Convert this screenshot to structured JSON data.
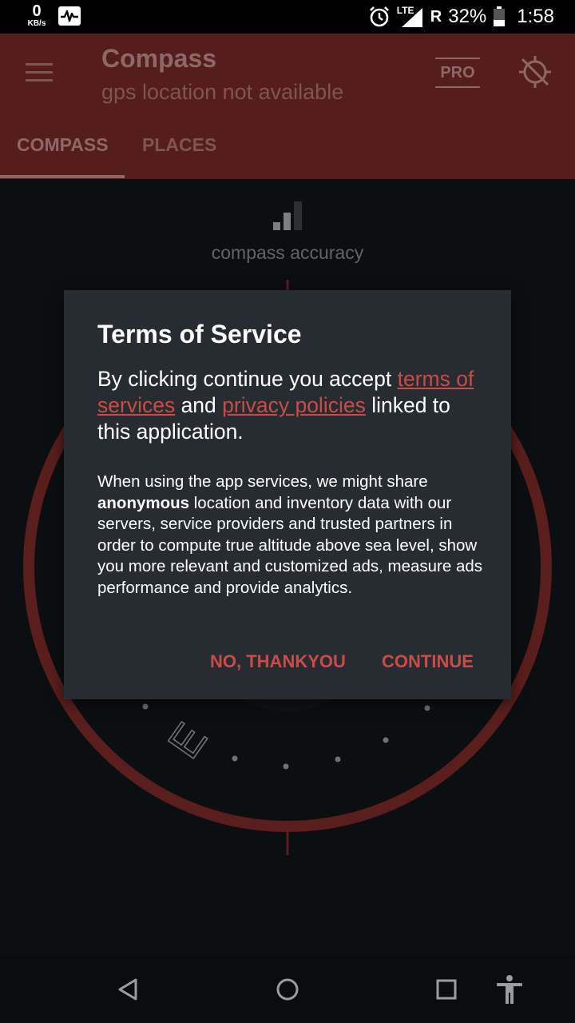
{
  "status_bar": {
    "net_speed_value": "0",
    "net_speed_unit": "KB/s",
    "network_type": "LTE",
    "roaming": "R",
    "battery_percent": "32%",
    "time": "1:58"
  },
  "app_bar": {
    "title": "Compass",
    "subtitle": "gps location not available",
    "pro_label": "PRO",
    "tabs": [
      {
        "label": "COMPASS",
        "active": true
      },
      {
        "label": "PLACES",
        "active": false
      }
    ]
  },
  "compass": {
    "accuracy_label": "compass accuracy",
    "east_letter": "E"
  },
  "dialog": {
    "title": "Terms of Service",
    "lead_prefix": "By clicking continue you accept ",
    "terms_link": "terms of services",
    "lead_middle": " and ",
    "privacy_link": "privacy policies",
    "lead_suffix": " linked to this application.",
    "body_prefix": "When using the app services, we might share ",
    "body_bold": "anonymous",
    "body_suffix": " location and inventory data with our servers, service providers and trusted partners in order to compute true altitude above sea level, show you more relevant and customized ads, measure ads performance and provide analytics.",
    "decline_label": "NO, THANKYOU",
    "accept_label": "CONTINUE"
  },
  "colors": {
    "accent": "#cc4b44",
    "appbar_dimmed": "#551e1c",
    "dialog_bg": "#262c31",
    "dial_ring": "#5a1f1d"
  }
}
